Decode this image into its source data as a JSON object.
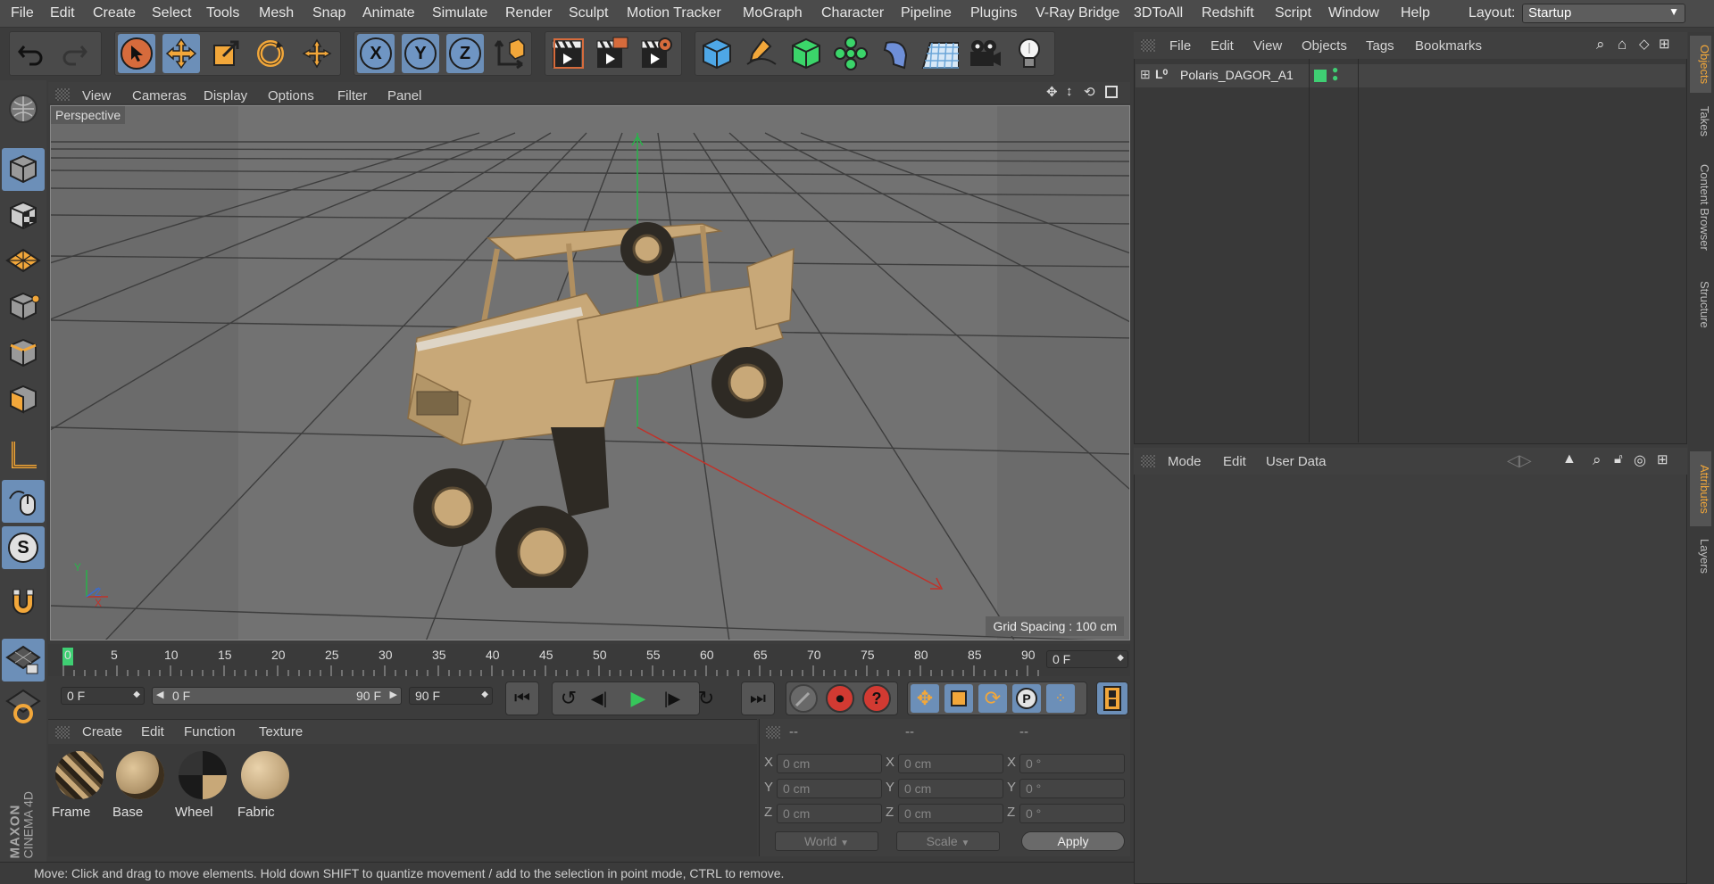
{
  "menubar": {
    "items": [
      "File",
      "Edit",
      "Create",
      "Select",
      "Tools",
      "Mesh",
      "Snap",
      "Animate",
      "Simulate",
      "Render",
      "Sculpt",
      "Motion Tracker",
      "MoGraph",
      "Character",
      "Pipeline",
      "Plugins",
      "V-Ray Bridge",
      "3DToAll",
      "Redshift",
      "Script",
      "Window",
      "Help"
    ],
    "layout_label": "Layout:",
    "layout_value": "Startup"
  },
  "toolbar": {
    "axis_x": "X",
    "axis_y": "Y",
    "axis_z": "Z"
  },
  "viewport": {
    "menu": [
      "View",
      "Cameras",
      "Display",
      "Options",
      "Filter",
      "Panel"
    ],
    "camera_label": "Perspective",
    "grid_spacing": "Grid Spacing : 100 cm",
    "axis_y": "Y",
    "axis_z": "Z",
    "axis_x": "X"
  },
  "timeline": {
    "ticks": [
      "0",
      "5",
      "10",
      "15",
      "20",
      "25",
      "30",
      "35",
      "40",
      "45",
      "50",
      "55",
      "60",
      "65",
      "70",
      "75",
      "80",
      "85",
      "90"
    ],
    "current_frame": "0 F",
    "start_frame": "0 F",
    "range_start": "0 F",
    "range_end": "90 F",
    "end_frame": "90 F"
  },
  "materials": {
    "menu": [
      "Create",
      "Edit",
      "Function",
      "Texture"
    ],
    "items": [
      "Frame",
      "Base",
      "Wheel",
      "Fabric"
    ]
  },
  "coordinates": {
    "headers": [
      "--",
      "--",
      "--"
    ],
    "rows": [
      {
        "axis": "X",
        "pos": "0 cm",
        "size": "0 cm",
        "rot_axis": "X",
        "rot": "0 °"
      },
      {
        "axis": "Y",
        "pos": "0 cm",
        "size": "0 cm",
        "rot_axis": "Y",
        "rot": "0 °"
      },
      {
        "axis": "Z",
        "pos": "0 cm",
        "size": "0 cm",
        "rot_axis": "Z",
        "rot": "0 °"
      }
    ],
    "mode_world": "World",
    "mode_scale": "Scale",
    "apply": "Apply"
  },
  "objects_panel": {
    "menu": [
      "File",
      "Edit",
      "View",
      "Objects",
      "Tags",
      "Bookmarks"
    ],
    "object_name": "Polaris_DAGOR_A1"
  },
  "attributes_panel": {
    "menu": [
      "Mode",
      "Edit",
      "User Data"
    ]
  },
  "right_tabs": [
    "Objects",
    "Takes",
    "Content Browser",
    "Structure"
  ],
  "right_tabs_lower": [
    "Attributes",
    "Layers"
  ],
  "logo": {
    "brand": "MAXON",
    "product": "CINEMA 4D"
  },
  "status_bar": "Move: Click and drag to move elements. Hold down SHIFT to quantize movement / add to the selection in point mode, CTRL to remove.",
  "colors": {
    "accent_blue": "#6c8fb8",
    "timeline_marker": "#3fcf73",
    "vehicle_tan": "#c8a878"
  }
}
